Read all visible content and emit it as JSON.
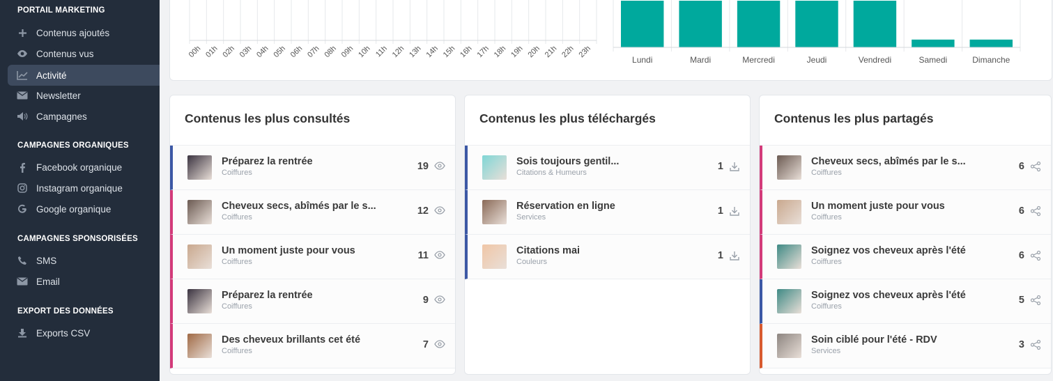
{
  "sidebar": {
    "sections": [
      {
        "title": "PORTAIL MARKETING",
        "items": [
          {
            "label": "Contenus ajoutés",
            "icon": "plus-icon"
          },
          {
            "label": "Contenus vus",
            "icon": "eye-icon"
          },
          {
            "label": "Activité",
            "icon": "activity-chart-icon",
            "active": true
          },
          {
            "label": "Newsletter",
            "icon": "envelope-icon"
          },
          {
            "label": "Campagnes",
            "icon": "megaphone-icon"
          }
        ]
      },
      {
        "title": "CAMPAGNES ORGANIQUES",
        "items": [
          {
            "label": "Facebook organique",
            "icon": "facebook-icon"
          },
          {
            "label": "Instagram organique",
            "icon": "instagram-icon"
          },
          {
            "label": "Google organique",
            "icon": "google-icon"
          }
        ]
      },
      {
        "title": "CAMPAGNES SPONSORISÉES",
        "items": [
          {
            "label": "SMS",
            "icon": "phone-icon"
          },
          {
            "label": "Email",
            "icon": "envelope-icon"
          }
        ]
      },
      {
        "title": "EXPORT DES DONNÉES",
        "items": [
          {
            "label": "Exports CSV",
            "icon": "download-icon"
          }
        ]
      }
    ]
  },
  "chart_data": [
    {
      "type": "bar",
      "categories": [
        "00h",
        "01h",
        "02h",
        "03h",
        "04h",
        "05h",
        "06h",
        "07h",
        "08h",
        "09h",
        "10h",
        "11h",
        "12h",
        "13h",
        "14h",
        "15h",
        "16h",
        "17h",
        "18h",
        "19h",
        "20h",
        "21h",
        "22h",
        "23h"
      ],
      "values": [
        0,
        0,
        0,
        0,
        0,
        0,
        0,
        0,
        0,
        0,
        0,
        0,
        0,
        0,
        0,
        0,
        0,
        0,
        0,
        0,
        0,
        0,
        0,
        0
      ],
      "title": "",
      "xlabel": "",
      "ylabel": "",
      "grid": true
    },
    {
      "type": "bar",
      "categories": [
        "Lundi",
        "Mardi",
        "Mercredi",
        "Jeudi",
        "Vendredi",
        "Samedi",
        "Dimanche"
      ],
      "values": [
        6,
        6,
        6,
        6,
        6,
        1,
        1
      ],
      "ylim": [
        0,
        6
      ],
      "color": "#00a99d",
      "title": "",
      "xlabel": "",
      "ylabel": "",
      "grid": true
    }
  ],
  "panels": {
    "consultes": {
      "title": "Contenus les plus consultés",
      "rows": [
        {
          "title": "Préparez la rentrée",
          "sub": "Coiffures",
          "count": "19",
          "accent": "blue",
          "thumb": "#3a3340"
        },
        {
          "title": "Cheveux secs, abîmés par le s...",
          "sub": "Coiffures",
          "count": "12",
          "accent": "pink",
          "thumb": "#6b5a52"
        },
        {
          "title": "Un moment juste pour vous",
          "sub": "Coiffures",
          "count": "11",
          "accent": "pink",
          "thumb": "#c9a88e"
        },
        {
          "title": "Préparez la rentrée",
          "sub": "Coiffures",
          "count": "9",
          "accent": "pink",
          "thumb": "#3a3340"
        },
        {
          "title": "Des cheveux brillants cet été",
          "sub": "Coiffures",
          "count": "7",
          "accent": "pink",
          "thumb": "#a06a45"
        }
      ]
    },
    "telecharges": {
      "title": "Contenus les plus téléchargés",
      "rows": [
        {
          "title": "Sois toujours gentil...",
          "sub": "Citations & Humeurs",
          "count": "1",
          "accent": "blue",
          "thumb": "#7fd6d6"
        },
        {
          "title": "Réservation en ligne",
          "sub": "Services",
          "count": "1",
          "accent": "blue",
          "thumb": "#8a6a58"
        },
        {
          "title": "Citations mai",
          "sub": "Couleurs",
          "count": "1",
          "accent": "blue",
          "thumb": "#f0c6a6"
        }
      ]
    },
    "partages": {
      "title": "Contenus les plus partagés",
      "rows": [
        {
          "title": "Cheveux secs, abîmés par le s...",
          "sub": "Coiffures",
          "count": "6",
          "accent": "pink",
          "thumb": "#6b5a52"
        },
        {
          "title": "Un moment juste pour vous",
          "sub": "Coiffures",
          "count": "6",
          "accent": "pink",
          "thumb": "#c9a88e"
        },
        {
          "title": "Soignez vos cheveux après l'été",
          "sub": "Coiffures",
          "count": "6",
          "accent": "pink",
          "thumb": "#3f8a85"
        },
        {
          "title": "Soignez vos cheveux après l'été",
          "sub": "Coiffures",
          "count": "5",
          "accent": "blue",
          "thumb": "#3f8a85"
        },
        {
          "title": "Soin ciblé pour l'été - RDV",
          "sub": "Services",
          "count": "3",
          "accent": "orange",
          "thumb": "#8d8580"
        }
      ]
    }
  }
}
